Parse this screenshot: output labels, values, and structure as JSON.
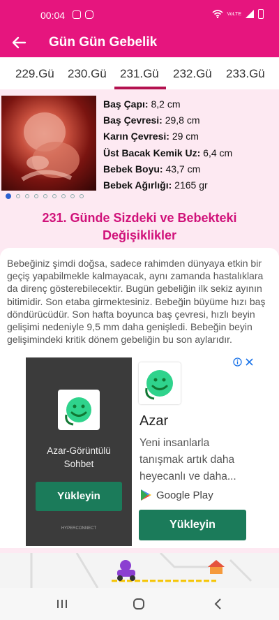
{
  "status_bar": {
    "time": "00:04",
    "network": "VoLTE"
  },
  "app_bar": {
    "title": "Gün Gün Gebelik"
  },
  "tabs": [
    {
      "label": "229.Gü"
    },
    {
      "label": "230.Gü"
    },
    {
      "label": "231.Gü",
      "selected": true
    },
    {
      "label": "232.Gü"
    },
    {
      "label": "233.Gü"
    }
  ],
  "specs": [
    {
      "label": "Baş Çapı:",
      "value": "8,2 cm"
    },
    {
      "label": "Baş Çevresi:",
      "value": "29,8 cm"
    },
    {
      "label": "Karın Çevresi:",
      "value": "29 cm"
    },
    {
      "label": "Üst Bacak Kemik Uz:",
      "value": "6,4 cm"
    },
    {
      "label": "Bebek Boyu:",
      "value": "43,7 cm"
    },
    {
      "label": "Bebek Ağırlığı:",
      "value": "2165 gr"
    }
  ],
  "carousel": {
    "count": 9,
    "active_index": 0
  },
  "section": {
    "heading_line1": "231. Günde Sizdeki ve Bebekteki",
    "heading_line2": "Değişiklikler",
    "paragraph": "Bebeğiniz şimdi doğsa, sadece rahimden dünyaya etkin bir geçiş yapabilmekle kalmayacak, aynı zamanda hastalıklara da direnç gösterebilecektir. Bugün gebeliğin ilk sekiz ayının bitimidir. Son etaba girmektesiniz. Bebeğin büyüme hızı baş döndürücüdür. Son hafta boyunca baş çevresi, hızlı beyin gelişimi nedeniyle 9,5 mm daha genişledi. Bebeğin beyin gelişimindeki kritik dönem gebeliğin bu son aylarıdır."
  },
  "ad": {
    "left_app_line1": "Azar-Görüntülü",
    "left_app_line2": "Sohbet",
    "left_install": "Yükleyin",
    "left_brand": "HYPERCONNECT",
    "app_name": "Azar",
    "description": "Yeni insanlarla tanışmak artık daha heyecanlı ve daha...",
    "store": "Google Play",
    "install": "Yükleyin",
    "brand_color": "#1b7b5a"
  },
  "colors": {
    "primary": "#e6157e",
    "heading": "#d0127a",
    "tab_indicator": "#b3124f"
  }
}
